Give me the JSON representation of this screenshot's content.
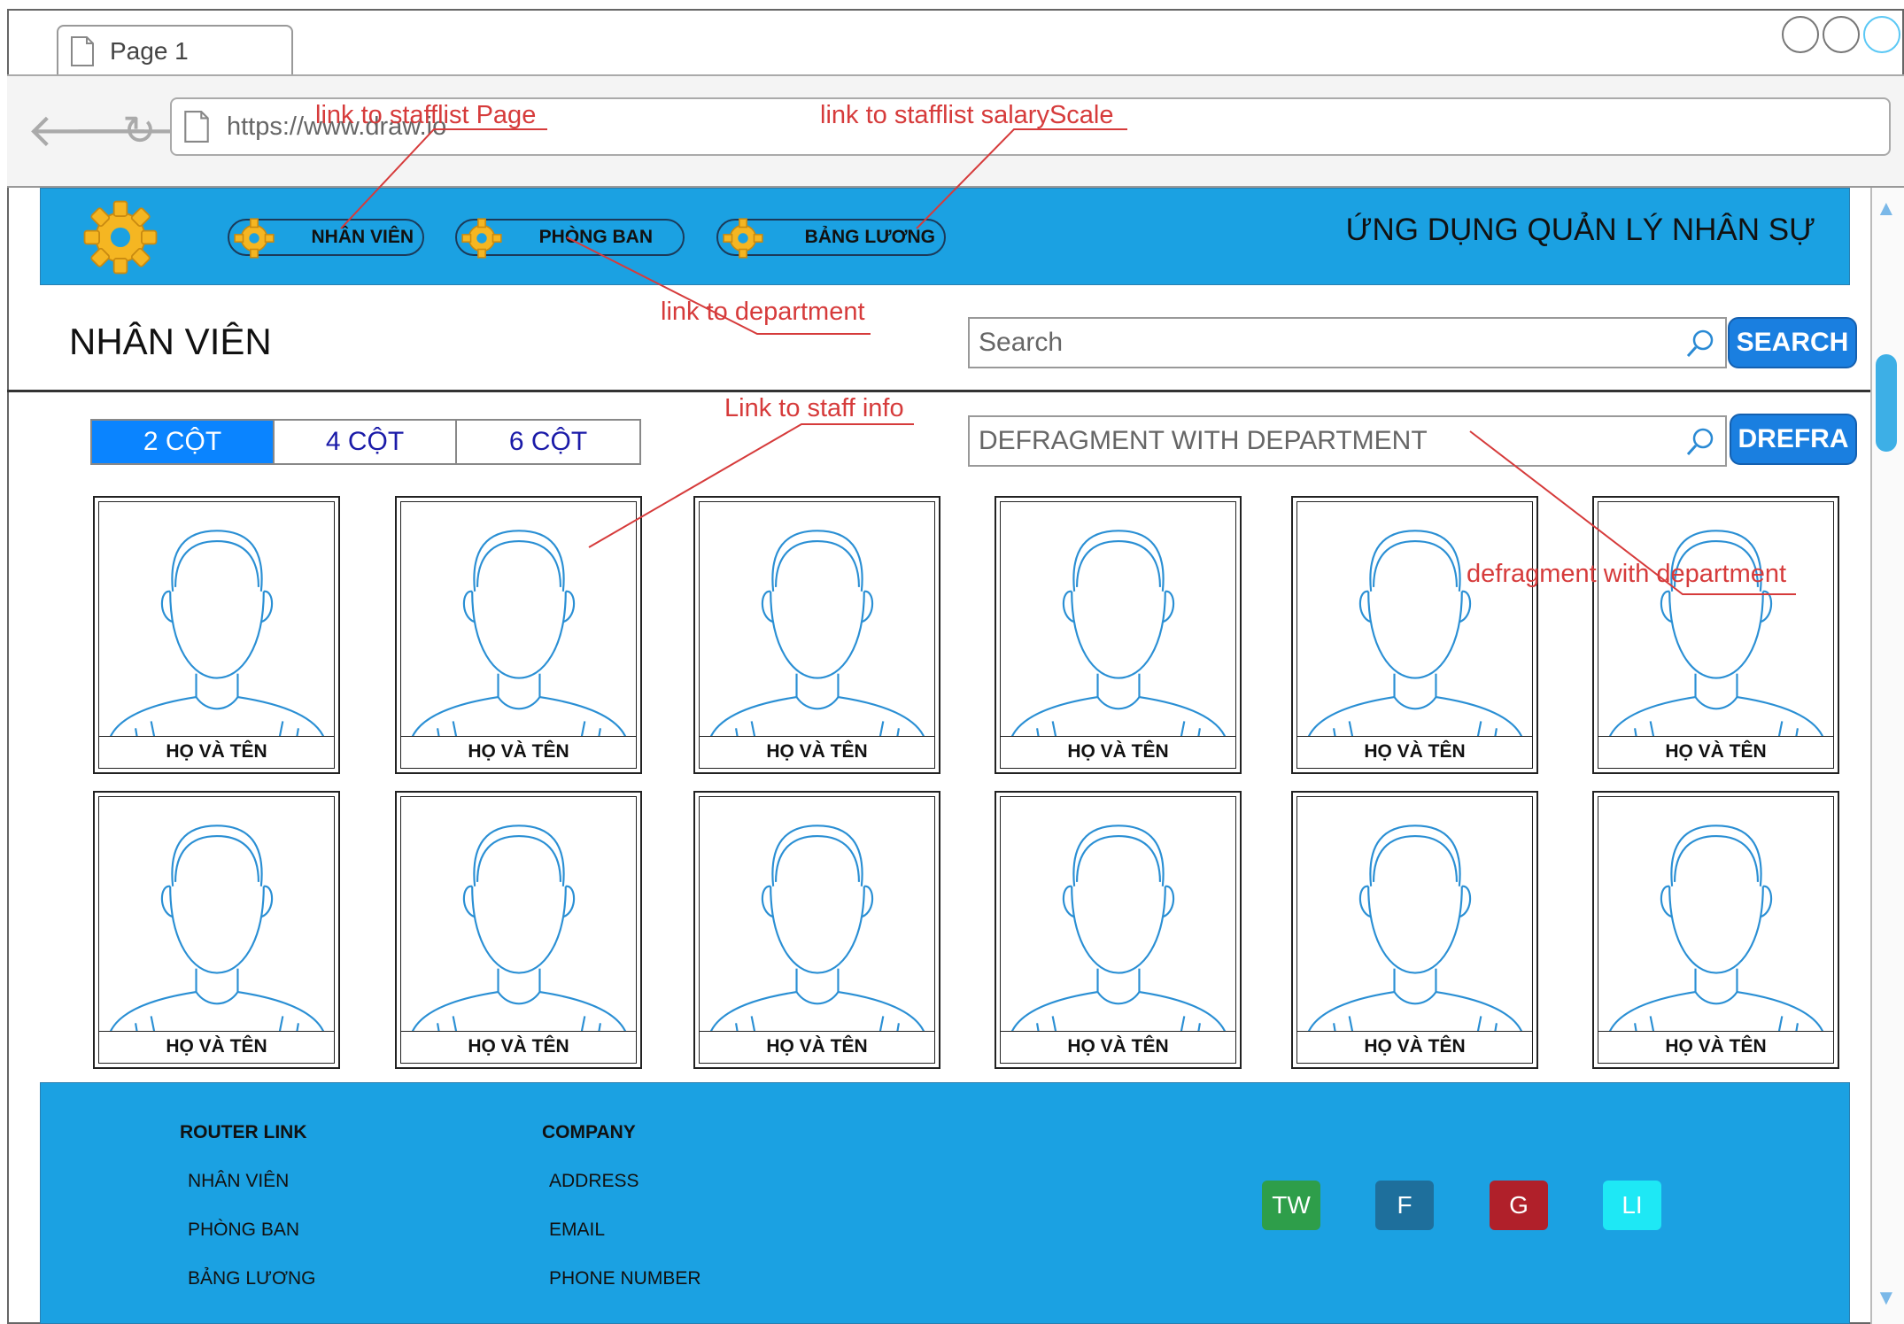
{
  "browser": {
    "tab_label": "Page 1",
    "url": "https://www.draw.io"
  },
  "header": {
    "app_title": "ỨNG DỤNG QUẢN LÝ NHÂN SỰ",
    "nav": [
      {
        "label": "NHÂN VIÊN"
      },
      {
        "label": "PHÒNG BAN"
      },
      {
        "label": "BẢNG LƯƠNG"
      }
    ]
  },
  "page": {
    "title": "NHÂN VIÊN",
    "search_placeholder": "Search",
    "search_button": "SEARCH",
    "filter_value": "DEFRAGMENT WITH DEPARTMENT",
    "filter_button": "DREFRA"
  },
  "column_toggle": {
    "options": [
      "2 CỘT",
      "4 CỘT",
      "6 CỘT"
    ],
    "active": "2 CỘT"
  },
  "staff_cards": {
    "name_label": "HỌ VÀ TÊN"
  },
  "footer": {
    "router_heading": "ROUTER LINK",
    "router_links": [
      "NHÂN VIÊN",
      "PHÒNG BAN",
      "BẢNG LƯƠNG"
    ],
    "company_heading": "COMPANY",
    "company_links": [
      "ADDRESS",
      "EMAIL",
      "PHONE NUMBER"
    ],
    "social": [
      {
        "label": "TW",
        "color": "#2e9e4a"
      },
      {
        "label": "F",
        "color": "#1e6f9c"
      },
      {
        "label": "G",
        "color": "#b0202a"
      },
      {
        "label": "LI",
        "color": "#1ee8f5"
      }
    ]
  },
  "annotations": {
    "staff_list": "link to stafflist Page",
    "salary": "link to stafflist salaryScale",
    "department": "link to department",
    "staff_info": "Link to staff info",
    "defragment": "defragment with department"
  },
  "colors": {
    "header_bg": "#1ba1e2",
    "button_blue": "#1a7fe0",
    "annotation_red": "#d63b3b"
  }
}
